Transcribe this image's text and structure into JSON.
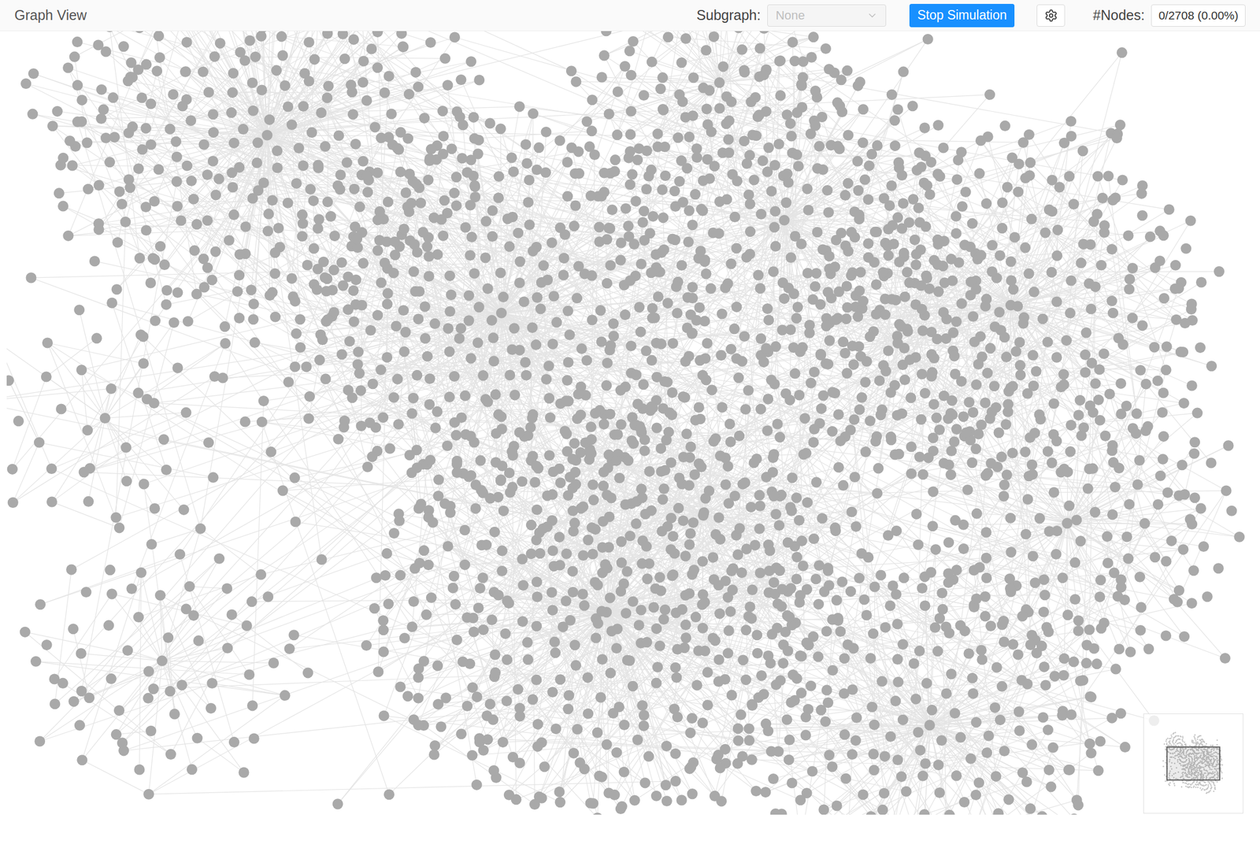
{
  "window": {
    "title": "Graph View"
  },
  "subgraph": {
    "label": "Subgraph:",
    "value": "None"
  },
  "simulation": {
    "button": "Stop Simulation",
    "running": true
  },
  "nodes_counter": {
    "label": "#Nodes:",
    "value": "0/2708 (0.00%)"
  }
}
